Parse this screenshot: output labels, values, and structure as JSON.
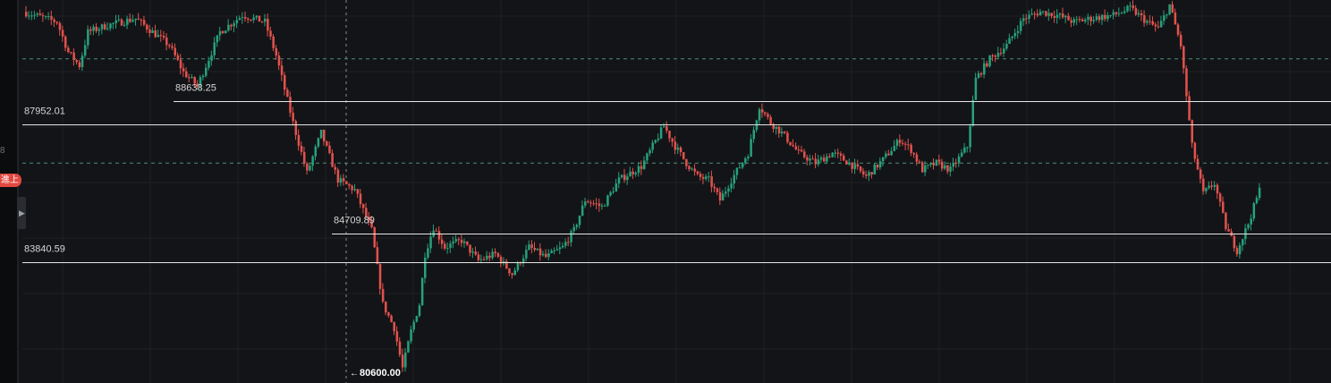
{
  "left_panel": {
    "badge_label": "進上",
    "stub_label": "8",
    "collapse_arrow": "caret-right-icon"
  },
  "colors": {
    "background": "#131417",
    "grid": "#1e2024",
    "up": "#26a17b",
    "down": "#e2524d",
    "level_line": "#e6e6e6",
    "dashed": "#4c8f74",
    "crosshair": "#8a8d93",
    "label_text": "#d6d6d6"
  },
  "chart_data": {
    "type": "candlestick",
    "grid": true,
    "y_range": [
      80000,
      91200
    ],
    "horizontal_levels": [
      {
        "label": "88638.25",
        "value": 88638.25
      },
      {
        "label": "87952.01",
        "value": 87952.01
      },
      {
        "label": "84709.89",
        "value": 84709.89
      },
      {
        "label": "83840.59",
        "value": 83840.59
      }
    ],
    "dashed_levels": [
      89900,
      86800
    ],
    "low_marker": {
      "label": "80600.00",
      "value": 80600.0
    },
    "candle_count": 440,
    "waypoints": [
      [
        0,
        91300
      ],
      [
        12,
        91000
      ],
      [
        16,
        90100
      ],
      [
        20,
        89700
      ],
      [
        23,
        90700
      ],
      [
        30,
        90900
      ],
      [
        40,
        91100
      ],
      [
        46,
        90700
      ],
      [
        52,
        90300
      ],
      [
        57,
        89500
      ],
      [
        62,
        89100
      ],
      [
        66,
        89900
      ],
      [
        70,
        90700
      ],
      [
        78,
        91200
      ],
      [
        86,
        91000
      ],
      [
        90,
        90000
      ],
      [
        96,
        88000
      ],
      [
        101,
        86500
      ],
      [
        106,
        87700
      ],
      [
        112,
        86300
      ],
      [
        118,
        86000
      ],
      [
        124,
        84800
      ],
      [
        128,
        82600
      ],
      [
        132,
        81900
      ],
      [
        135,
        80700
      ],
      [
        138,
        81800
      ],
      [
        141,
        82600
      ],
      [
        143,
        84100
      ],
      [
        146,
        84900
      ],
      [
        150,
        84300
      ],
      [
        156,
        84500
      ],
      [
        162,
        83900
      ],
      [
        168,
        84100
      ],
      [
        174,
        83500
      ],
      [
        180,
        84300
      ],
      [
        186,
        84000
      ],
      [
        192,
        84300
      ],
      [
        196,
        84800
      ],
      [
        200,
        85700
      ],
      [
        206,
        85500
      ],
      [
        212,
        86300
      ],
      [
        220,
        86700
      ],
      [
        224,
        87300
      ],
      [
        228,
        87900
      ],
      [
        232,
        87300
      ],
      [
        236,
        86800
      ],
      [
        240,
        86400
      ],
      [
        244,
        86300
      ],
      [
        248,
        85700
      ],
      [
        252,
        86300
      ],
      [
        258,
        87100
      ],
      [
        262,
        88500
      ],
      [
        266,
        88000
      ],
      [
        270,
        87700
      ],
      [
        276,
        87100
      ],
      [
        282,
        86800
      ],
      [
        288,
        87100
      ],
      [
        294,
        86800
      ],
      [
        300,
        86400
      ],
      [
        306,
        86900
      ],
      [
        312,
        87500
      ],
      [
        316,
        87200
      ],
      [
        320,
        86600
      ],
      [
        325,
        86800
      ],
      [
        330,
        86600
      ],
      [
        336,
        87300
      ],
      [
        339,
        89300
      ],
      [
        344,
        89900
      ],
      [
        350,
        90300
      ],
      [
        356,
        91100
      ],
      [
        362,
        91300
      ],
      [
        368,
        91200
      ],
      [
        374,
        91000
      ],
      [
        380,
        91100
      ],
      [
        388,
        91200
      ],
      [
        394,
        91400
      ],
      [
        400,
        91000
      ],
      [
        404,
        90800
      ],
      [
        408,
        91500
      ],
      [
        412,
        90300
      ],
      [
        416,
        87300
      ],
      [
        420,
        85900
      ],
      [
        424,
        86200
      ],
      [
        428,
        84900
      ],
      [
        432,
        84200
      ],
      [
        436,
        85000
      ],
      [
        440,
        86000
      ],
      [
        444,
        86400
      ],
      [
        448,
        86600
      ]
    ]
  }
}
